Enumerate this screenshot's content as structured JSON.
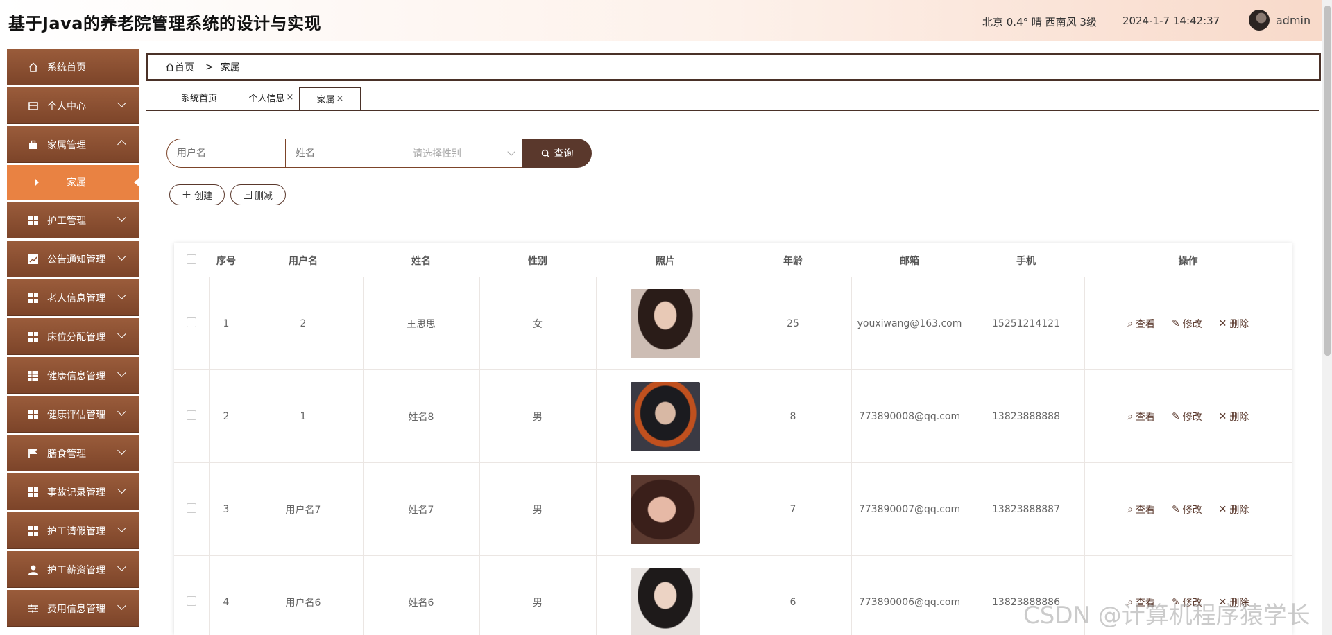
{
  "header": {
    "title": "基于Java的养老院管理系统的设计与实现",
    "weather": "北京  0.4°  晴  西南风  3级",
    "datetime": "2024-1-7 14:42:37",
    "user": "admin"
  },
  "sidebar": {
    "items": [
      {
        "label": "系统首页",
        "icon": "home-icon"
      },
      {
        "label": "个人中心",
        "icon": "card-icon"
      },
      {
        "label": "家属管理",
        "icon": "briefcase-icon",
        "expanded": true
      },
      {
        "label": "护工管理",
        "icon": "grid-icon"
      },
      {
        "label": "公告通知管理",
        "icon": "chart-icon"
      },
      {
        "label": "老人信息管理",
        "icon": "grid-icon"
      },
      {
        "label": "床位分配管理",
        "icon": "grid-icon"
      },
      {
        "label": "健康信息管理",
        "icon": "table-icon"
      },
      {
        "label": "健康评估管理",
        "icon": "grid-icon"
      },
      {
        "label": "膳食管理",
        "icon": "flag-icon"
      },
      {
        "label": "事故记录管理",
        "icon": "grid-icon"
      },
      {
        "label": "护工请假管理",
        "icon": "grid-icon"
      },
      {
        "label": "护工薪资管理",
        "icon": "user-icon"
      },
      {
        "label": "费用信息管理",
        "icon": "sliders-icon"
      }
    ],
    "subitem": "家属"
  },
  "breadcrumb": {
    "home": "首页",
    "sep": ">",
    "current": "家属"
  },
  "tabs": [
    {
      "label": "系统首页",
      "closable": false
    },
    {
      "label": "个人信息",
      "closable": true
    },
    {
      "label": "家属",
      "closable": true,
      "active": true
    }
  ],
  "search": {
    "username_placeholder": "用户名",
    "name_placeholder": "姓名",
    "gender_placeholder": "请选择性别",
    "button": "查询"
  },
  "actions": {
    "create": "创建",
    "delete": "删减"
  },
  "table": {
    "columns": [
      "序号",
      "用户名",
      "姓名",
      "性别",
      "照片",
      "年龄",
      "邮箱",
      "手机",
      "操作"
    ],
    "rows": [
      {
        "idx": "1",
        "username": "2",
        "name": "王思思",
        "gender": "女",
        "age": "25",
        "email": "youxiwang@163.com",
        "phone": "15251214121"
      },
      {
        "idx": "2",
        "username": "1",
        "name": "姓名8",
        "gender": "男",
        "age": "8",
        "email": "773890008@qq.com",
        "phone": "13823888888"
      },
      {
        "idx": "3",
        "username": "用户名7",
        "name": "姓名7",
        "gender": "男",
        "age": "7",
        "email": "773890007@qq.com",
        "phone": "13823888887"
      },
      {
        "idx": "4",
        "username": "用户名6",
        "name": "姓名6",
        "gender": "男",
        "age": "6",
        "email": "773890006@qq.com",
        "phone": "13823888886"
      }
    ],
    "ops": {
      "view": "查看",
      "edit": "修改",
      "delete": "删除"
    }
  },
  "watermark": "CSDN @计算机程序猿学长",
  "colors": {
    "accent": "#5a382c",
    "sidebar": "#8b4f33",
    "active": "#e98242"
  }
}
